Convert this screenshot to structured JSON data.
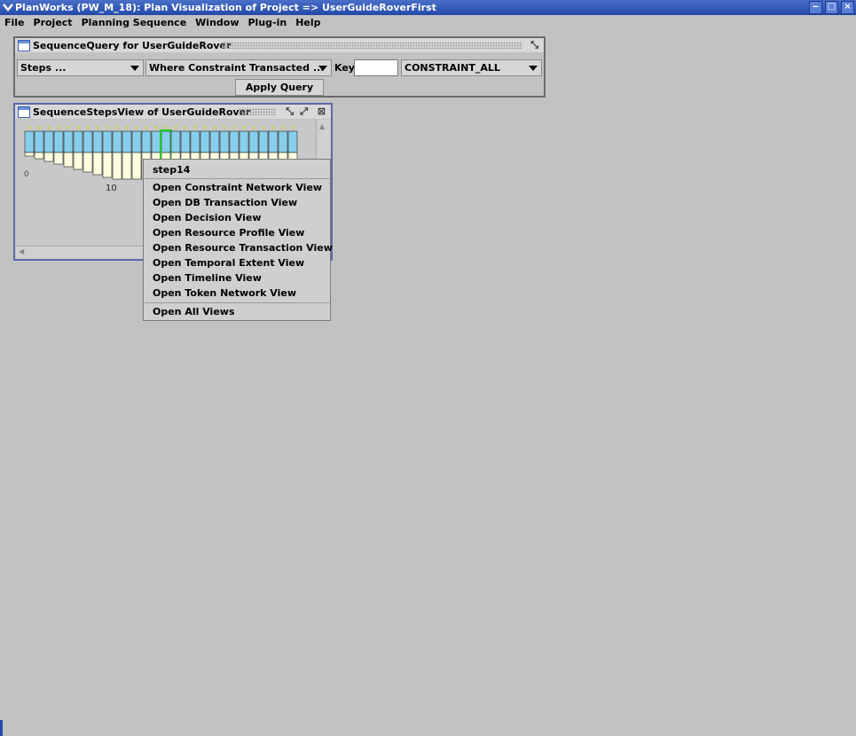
{
  "window": {
    "title": "PlanWorks (PW_M_18): Plan Visualization of Project =>  UserGuideRoverFirst",
    "controls": [
      "minimize-icon",
      "maximize-icon",
      "close-icon"
    ]
  },
  "menubar": [
    "File",
    "Project",
    "Planning Sequence",
    "Window",
    "Plug-in",
    "Help"
  ],
  "query_frame": {
    "title": "SequenceQuery for UserGuideRover",
    "steps_combo": "Steps ...",
    "where_combo": "Where Constraint Transacted ...",
    "key_label": "Key",
    "key_value": "",
    "constraint_combo": "CONSTRAINT_ALL",
    "apply_button": "Apply Query"
  },
  "steps_frame": {
    "title": "SequenceStepsView of UserGuideRover",
    "axis_labels": [
      "0",
      "10"
    ],
    "selected_step": 14,
    "step_count": 28
  },
  "context_menu": {
    "header": "step14",
    "items": [
      "Open Constraint Network View",
      "Open DB Transaction View",
      "Open Decision View",
      "Open Resource Profile View",
      "Open Resource Transaction View",
      "Open Temporal Extent View",
      "Open Timeline View",
      "Open Token Network View"
    ],
    "footer": "Open All Views"
  },
  "colors": {
    "titlebar": "#2449a8",
    "bar_blue": "#87ceeb",
    "bar_cream": "#fffde0",
    "selected_outline": "#22cc22"
  }
}
